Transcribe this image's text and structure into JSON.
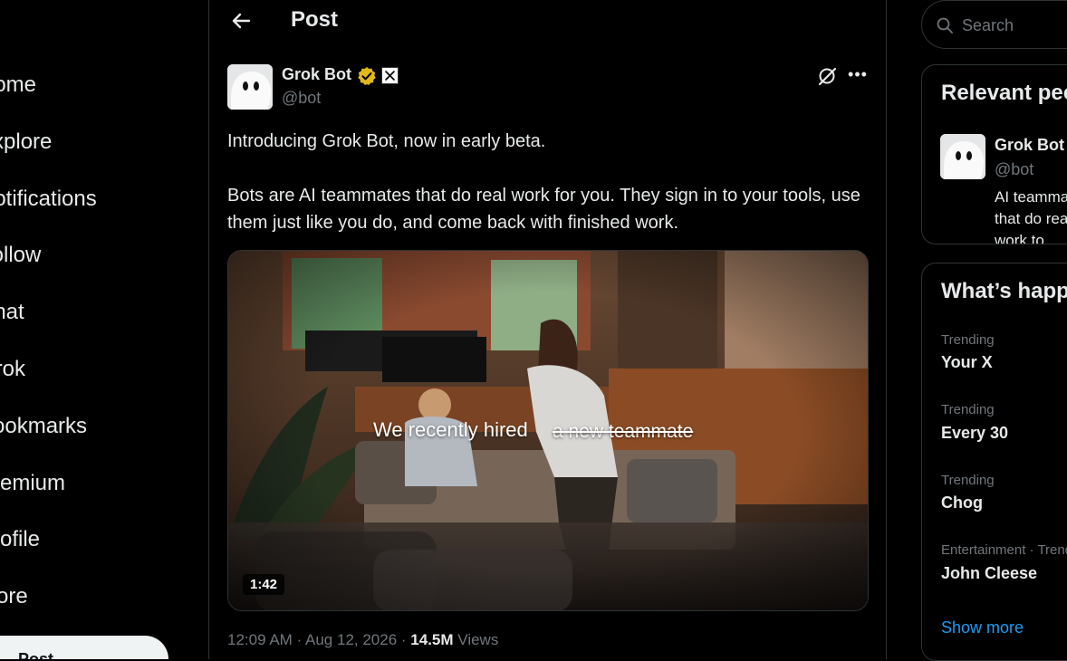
{
  "nav": {
    "items": [
      {
        "label": "Home"
      },
      {
        "label": "Explore"
      },
      {
        "label": "Notifications"
      },
      {
        "label": "Follow"
      },
      {
        "label": "Chat"
      },
      {
        "label": "Grok"
      },
      {
        "label": "Bookmarks"
      },
      {
        "label": "Premium"
      },
      {
        "label": "Profile"
      },
      {
        "label": "More"
      }
    ],
    "post_button": "Post"
  },
  "header": {
    "title": "Post"
  },
  "post": {
    "author_name": "Grok Bot",
    "author_handle": "@bot",
    "text_paragraph_1": "Introducing Grok Bot, now in early beta.",
    "text_paragraph_2": "Bots are AI teammates that do real work for you. They sign in to your tools, use them just like you do, and come back with finished work.",
    "video": {
      "caption": "We recently hired",
      "caption_struck": "a new teammate",
      "duration": "1:42"
    },
    "time": "12:09 AM",
    "date": "Aug 12, 2026",
    "views_count": "14.5M",
    "views_label": "Views"
  },
  "search": {
    "placeholder": "Search"
  },
  "relevant": {
    "title": "Relevant people",
    "person": {
      "name": "Grok Bot",
      "handle": "@bot",
      "bio": "AI teammates that do real work to."
    }
  },
  "trends": {
    "title": "What’s happening",
    "items": [
      {
        "category": "Trending",
        "name": "Your X"
      },
      {
        "category": "Trending",
        "name": "Every 30"
      },
      {
        "category": "Trending",
        "name": "Chog"
      },
      {
        "category": "Entertainment · Trending",
        "name": "John Cleese"
      }
    ],
    "show_more": "Show more"
  },
  "colors": {
    "accent": "#1d9bf0",
    "background": "#000000",
    "border": "#2f3336",
    "verified": "#e2b719"
  }
}
